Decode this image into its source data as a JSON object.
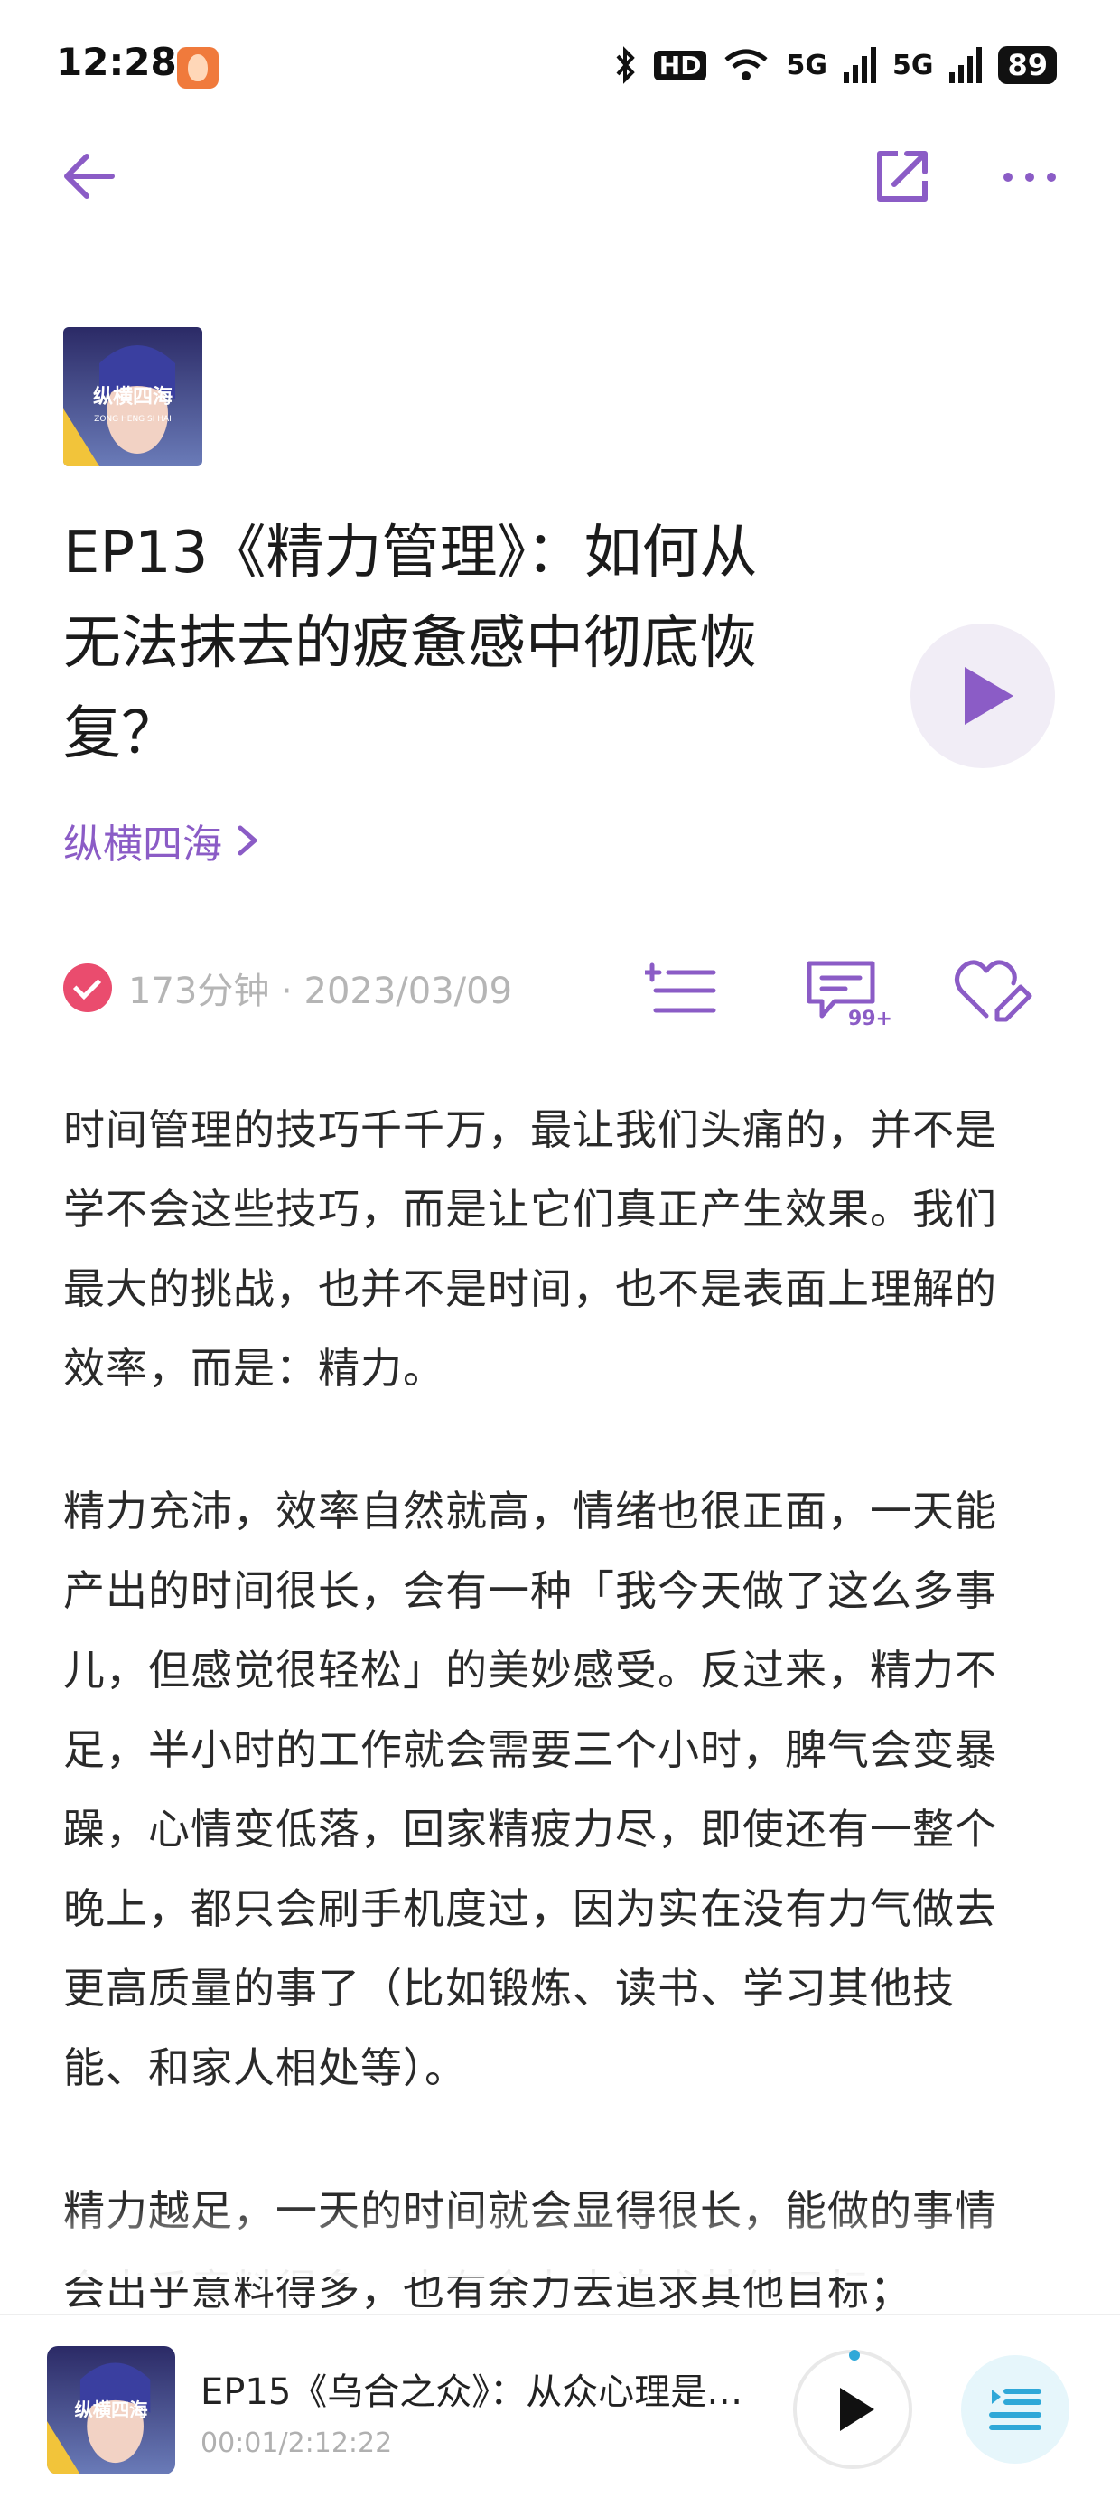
{
  "status_bar": {
    "time": "12:28",
    "hd_label": "HD",
    "network_1": "5G",
    "network_2": "5G",
    "battery": "89"
  },
  "episode": {
    "title": "EP13《精力管理》：如何从无法抹去的疲惫感中彻底恢复？",
    "author": "纵横四海",
    "meta": "173分钟 · 2023/03/09",
    "comment_count": "99+",
    "cover_text": "纵横四海",
    "cover_subtext": "ZONG HENG SI HAI"
  },
  "article": {
    "paragraphs": [
      "时间管理的技巧千千万，最让我们头痛的，并不是学不会这些技巧，而是让它们真正产生效果。我们最大的挑战，也并不是时间，也不是表面上理解的效率，而是：精力。",
      "精力充沛，效率自然就高，情绪也很正面，一天能产出的时间很长，会有一种「我今天做了这么多事儿，但感觉很轻松」的美妙感受。反过来，精力不足，半小时的工作就会需要三个小时，脾气会变暴躁，心情变低落，回家精疲力尽，即使还有一整个晚上，都只会刷手机度过，因为实在没有力气做去更高质量的事了（比如锻炼、读书、学习其他技能、和家人相处等）。",
      "精力越足，一天的时间就会显得很长，能做的事情会出乎意料得多，也有余力去追求其他目标；"
    ]
  },
  "mini_player": {
    "title": "EP15《乌合之众》：从众心理是…",
    "time": "00:01/2:12:22",
    "progress": 0.0001
  },
  "colors": {
    "accent": "#8b5cc6",
    "check": "#ea4c6e",
    "player_blue": "#2fa8d8"
  }
}
